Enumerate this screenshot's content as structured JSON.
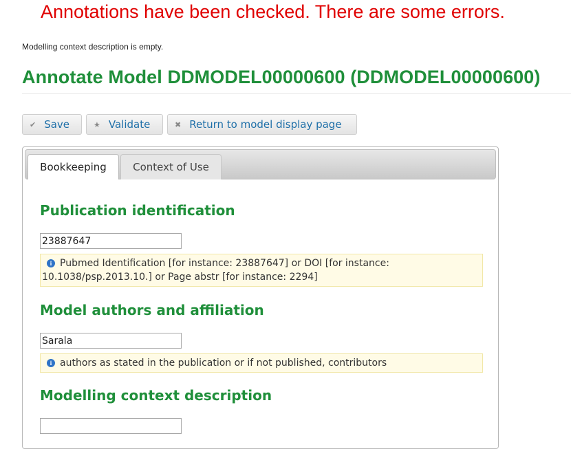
{
  "alert": "Annotations have been checked. There are some errors.",
  "note": "Modelling context description is empty.",
  "page_title": "Annotate Model DDMODEL00000600 (DDMODEL00000600)",
  "toolbar": {
    "save": "Save",
    "validate": "Validate",
    "return": "Return to model display page"
  },
  "icons": {
    "save": "checkmark-icon",
    "validate": "star-icon",
    "return": "cross-icon",
    "hint": "info-icon"
  },
  "tabs": [
    {
      "label": "Bookkeeping",
      "active": true
    },
    {
      "label": "Context of Use",
      "active": false
    }
  ],
  "sections": {
    "publication": {
      "title": "Publication identification",
      "value": "23887647",
      "hint_line1": "Pubmed Identification [for instance: 23887647] or DOI [for instance:",
      "hint_line2": "10.1038/psp.2013.10.] or Page abstr [for instance: 2294]"
    },
    "authors": {
      "title": "Model authors and affiliation",
      "value": "Sarala",
      "hint": "authors as stated in the publication or if not published, contributors"
    },
    "context": {
      "title": "Modelling context description",
      "value": ""
    }
  },
  "colors": {
    "alert": "#e00000",
    "heading": "#1f8f3a",
    "link": "#1e6fa8",
    "hint_bg": "#fffbe6"
  }
}
